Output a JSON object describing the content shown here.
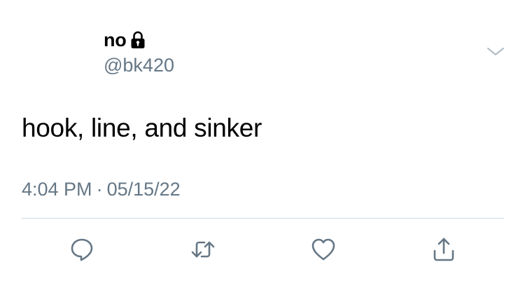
{
  "tweet": {
    "display_name": "no",
    "handle": "@bk420",
    "text": "hook, line, and sinker",
    "time": "4:04 PM",
    "separator": "·",
    "date": "05/15/22"
  },
  "icons": {
    "lock": "lock-icon",
    "chevron": "chevron-down-icon",
    "reply": "reply-icon",
    "retweet": "retweet-icon",
    "like": "heart-icon",
    "share": "share-icon"
  },
  "colors": {
    "text": "#000000",
    "secondary": "#657786",
    "icon": "#657786",
    "divider": "#ccd6dd"
  }
}
